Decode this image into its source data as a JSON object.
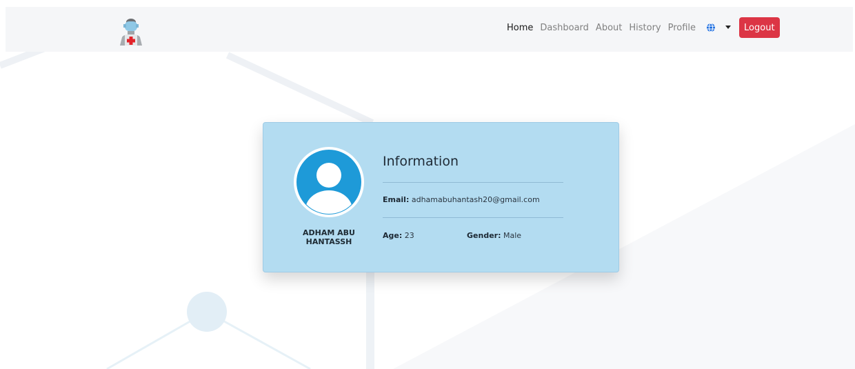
{
  "nav": {
    "links": [
      {
        "label": "Home",
        "active": true
      },
      {
        "label": "Dashboard",
        "active": false
      },
      {
        "label": "About",
        "active": false
      },
      {
        "label": "History",
        "active": false
      },
      {
        "label": "Profile",
        "active": false
      }
    ],
    "language_icon": "globe-icon",
    "dropdown_icon": "caret-down-icon",
    "logout_label": "Logout"
  },
  "profile": {
    "name": "ADHAM ABU HANTASSH",
    "info_title": "Information",
    "email_label": "Email:",
    "email": "adhamabuhantash20@gmail.com",
    "age_label": "Age:",
    "age": "23",
    "gender_label": "Gender:",
    "gender": "Male"
  },
  "colors": {
    "logout": "#dc3545",
    "card": "#b3dcf1",
    "avatar": "#1e9ad8"
  }
}
